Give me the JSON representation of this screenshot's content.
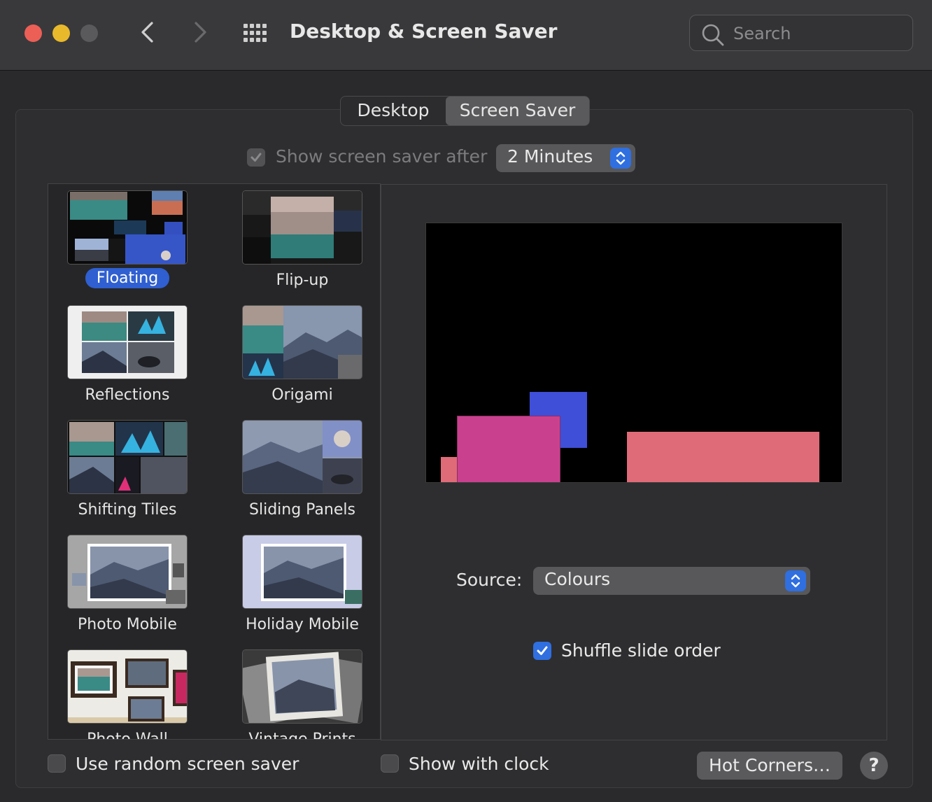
{
  "window": {
    "title": "Desktop & Screen Saver",
    "search_placeholder": "Search"
  },
  "tabs": [
    {
      "label": "Desktop",
      "selected": false
    },
    {
      "label": "Screen Saver",
      "selected": true
    }
  ],
  "show_after": {
    "label": "Show screen saver after",
    "checked": true,
    "enabled": false,
    "value": "2 Minutes"
  },
  "screen_savers": [
    {
      "label": "Floating",
      "selected": true
    },
    {
      "label": "Flip-up",
      "selected": false
    },
    {
      "label": "Reflections",
      "selected": false
    },
    {
      "label": "Origami",
      "selected": false
    },
    {
      "label": "Shifting Tiles",
      "selected": false
    },
    {
      "label": "Sliding Panels",
      "selected": false
    },
    {
      "label": "Photo Mobile",
      "selected": false
    },
    {
      "label": "Holiday Mobile",
      "selected": false
    },
    {
      "label": "Photo Wall",
      "selected": false
    },
    {
      "label": "Vintage Prints",
      "selected": false
    }
  ],
  "preview": {
    "colors": [
      "#3f4fd8",
      "#c9418e",
      "#e06b78"
    ]
  },
  "options": {
    "source_label": "Source:",
    "source_value": "Colours",
    "shuffle_label": "Shuffle slide order",
    "shuffle_checked": true
  },
  "bottom": {
    "random_label": "Use random screen saver",
    "random_checked": false,
    "clock_label": "Show with clock",
    "clock_checked": false,
    "hot_corners_label": "Hot Corners…",
    "help_label": "?"
  },
  "colors": {
    "accent": "#2f6fe0",
    "selection": "#2f5fd0",
    "close": "#ec5f57",
    "minimize": "#e9b92c"
  }
}
